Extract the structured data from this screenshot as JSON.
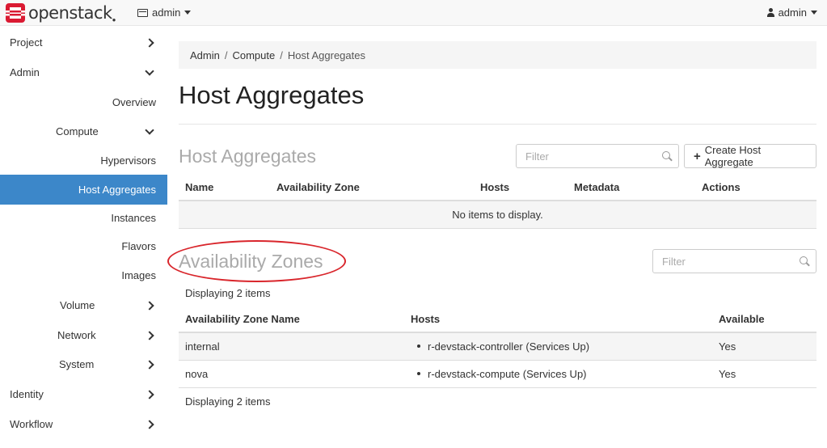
{
  "brand": {
    "name": "openstack",
    "accent": "#da1a32"
  },
  "topbar": {
    "project": "admin",
    "user": "admin"
  },
  "sidebar": {
    "items": [
      {
        "label": "Project"
      },
      {
        "label": "Admin"
      },
      {
        "label": "Overview"
      },
      {
        "label": "Compute"
      },
      {
        "label": "Hypervisors"
      },
      {
        "label": "Host Aggregates"
      },
      {
        "label": "Instances"
      },
      {
        "label": "Flavors"
      },
      {
        "label": "Images"
      },
      {
        "label": "Volume"
      },
      {
        "label": "Network"
      },
      {
        "label": "System"
      },
      {
        "label": "Identity"
      },
      {
        "label": "Workflow"
      }
    ],
    "active_color": "#3c87c9"
  },
  "breadcrumb": {
    "items": [
      "Admin",
      "Compute",
      "Host Aggregates"
    ]
  },
  "page": {
    "title": "Host Aggregates"
  },
  "host_aggregates": {
    "title": "Host Aggregates",
    "filter_placeholder": "Filter",
    "create_button": "Create Host Aggregate",
    "columns": [
      "Name",
      "Availability Zone",
      "Hosts",
      "Metadata",
      "Actions"
    ],
    "empty_text": "No items to display."
  },
  "availability_zones": {
    "title": "Availability Zones",
    "filter_placeholder": "Filter",
    "count_text": "Displaying 2 items",
    "columns": [
      "Availability Zone Name",
      "Hosts",
      "Available"
    ],
    "rows": [
      {
        "name": "internal",
        "hosts": "r-devstack-controller (Services Up)",
        "available": "Yes"
      },
      {
        "name": "nova",
        "hosts": "r-devstack-compute (Services Up)",
        "available": "Yes"
      }
    ],
    "footer_text": "Displaying 2 items"
  },
  "annotation_color": "#d9262c"
}
